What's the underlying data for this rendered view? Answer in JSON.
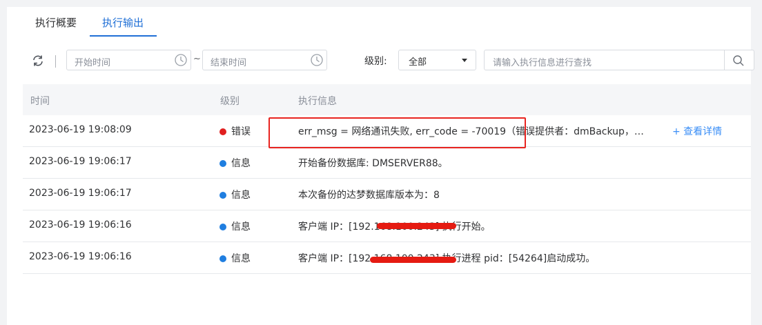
{
  "tabs": [
    {
      "label": "执行概要",
      "active": false
    },
    {
      "label": "执行输出",
      "active": true
    }
  ],
  "toolbar": {
    "start_time_placeholder": "开始时间",
    "range_separator": "~",
    "end_time_placeholder": "结束时间",
    "level_label": "级别:",
    "level_selected": "全部",
    "search_placeholder": "请输入执行信息进行查找"
  },
  "table": {
    "headers": [
      "时间",
      "级别",
      "执行信息"
    ],
    "rows": [
      {
        "time": "2023-06-19 19:08:09",
        "level": "错误",
        "level_type": "error",
        "message": "err_msg = 网络通讯失败, err_code = -70019（错误提供者：dmBackup，…",
        "detail_link": "+ 查看详情"
      },
      {
        "time": "2023-06-19 19:06:17",
        "level": "信息",
        "level_type": "info",
        "message": "开始备份数据库: DMSERVER88。"
      },
      {
        "time": "2023-06-19 19:06:17",
        "level": "信息",
        "level_type": "info",
        "message": "本次备份的达梦数据库版本为：8"
      },
      {
        "time": "2023-06-19 19:06:16",
        "level": "信息",
        "level_type": "info",
        "message": "客户端 IP：[192.168.100.243] 执行开始。"
      },
      {
        "time": "2023-06-19 19:06:16",
        "level": "信息",
        "level_type": "info",
        "message": "客户端 IP：[192.168.100.243] 执行进程 pid：[54264]启动成功。"
      }
    ]
  },
  "colors": {
    "accent": "#1f6fd6",
    "error": "#e02020",
    "info": "#1f7ee0",
    "highlight": "#e8231f"
  },
  "icons": {
    "refresh": "refresh-icon",
    "clock": "clock-icon",
    "search": "search-icon",
    "caret": "caret-down-icon"
  }
}
